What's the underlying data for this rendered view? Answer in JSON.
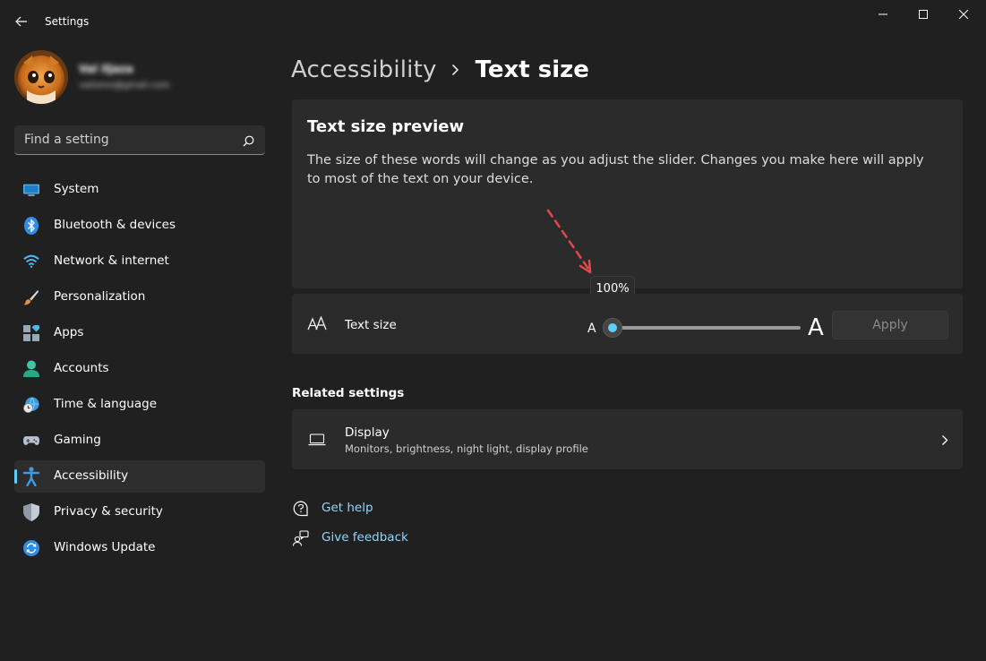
{
  "window": {
    "title": "Settings",
    "controls": [
      "minimize",
      "maximize",
      "close"
    ]
  },
  "user": {
    "name": "Val Iljaza",
    "email": "valiomo@gmail.com"
  },
  "search": {
    "placeholder": "Find a setting"
  },
  "sidebar": {
    "items": [
      {
        "label": "System",
        "icon": "monitor-icon",
        "active": false
      },
      {
        "label": "Bluetooth & devices",
        "icon": "bluetooth-icon",
        "active": false
      },
      {
        "label": "Network & internet",
        "icon": "wifi-icon",
        "active": false
      },
      {
        "label": "Personalization",
        "icon": "brush-icon",
        "active": false
      },
      {
        "label": "Apps",
        "icon": "apps-icon",
        "active": false
      },
      {
        "label": "Accounts",
        "icon": "person-icon",
        "active": false
      },
      {
        "label": "Time & language",
        "icon": "globe-clock-icon",
        "active": false
      },
      {
        "label": "Gaming",
        "icon": "gamepad-icon",
        "active": false
      },
      {
        "label": "Accessibility",
        "icon": "accessibility-icon",
        "active": true
      },
      {
        "label": "Privacy & security",
        "icon": "shield-icon",
        "active": false
      },
      {
        "label": "Windows Update",
        "icon": "update-icon",
        "active": false
      }
    ]
  },
  "breadcrumb": {
    "parent": "Accessibility",
    "current": "Text size"
  },
  "preview": {
    "title": "Text size preview",
    "text": "The size of these words will change as you adjust the slider. Changes you make here will apply to most of the text on your device."
  },
  "text_size": {
    "label": "Text size",
    "small_glyph": "A",
    "large_glyph": "A",
    "value_label": "100%",
    "slider_fraction": 0,
    "apply_label": "Apply"
  },
  "related": {
    "title": "Related settings",
    "display_title": "Display",
    "display_subtitle": "Monitors, brightness, night light, display profile"
  },
  "links": {
    "help": "Get help",
    "feedback": "Give feedback"
  },
  "colors": {
    "accent": "#60cdff",
    "background": "#202020",
    "card": "#2b2b2b",
    "link": "#8fd7ff",
    "annotation_arrow": "#e5474b"
  }
}
